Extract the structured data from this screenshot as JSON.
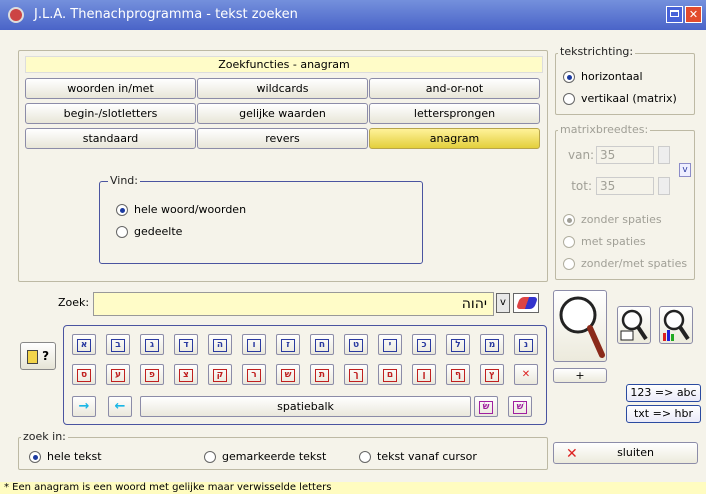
{
  "window": {
    "title": "J.L.A. Thenachprogramma - tekst zoeken"
  },
  "functions": {
    "header": "Zoekfuncties - anagram",
    "buttons": [
      "woorden in/met",
      "wildcards",
      "and-or-not",
      "begin-/slotletters",
      "gelijke waarden",
      "lettersprongen",
      "standaard",
      "revers",
      "anagram"
    ],
    "active": "anagram"
  },
  "vind": {
    "legend": "Vind:",
    "options": [
      "hele woord/woorden",
      "gedeelte"
    ],
    "selected": "hele woord/woorden"
  },
  "tekstrichting": {
    "legend": "tekstrichting:",
    "options": [
      "horizontaal",
      "vertikaal (matrix)"
    ],
    "selected": "horizontaal"
  },
  "matrix": {
    "legend": "matrixbreedtes:",
    "van_label": "van:",
    "van_value": "35",
    "tot_label": "tot:",
    "tot_value": "35",
    "v_button": "v",
    "options": [
      "zonder spaties",
      "met spaties",
      "zonder/met spaties"
    ],
    "selected": "zonder spaties"
  },
  "zoek": {
    "label": "Zoek:",
    "value": "יהוה",
    "dropdown": "v"
  },
  "help": {
    "label": "?"
  },
  "keyboard": {
    "row1": [
      "א",
      "ב",
      "ג",
      "ד",
      "ה",
      "ו",
      "ז",
      "ח",
      "ט",
      "י",
      "כ",
      "ל",
      "מ",
      "נ"
    ],
    "row2": [
      "ס",
      "ע",
      "פ",
      "צ",
      "ק",
      "ר",
      "ש",
      "ת",
      "ך",
      "ם",
      "ן",
      "ף",
      "ץ"
    ],
    "delete": "✕",
    "row3": [
      "שׂ",
      "שׁ"
    ],
    "arrow_right": "→",
    "arrow_left": "←",
    "space": "spatiebalk"
  },
  "tools": {
    "plus": "+",
    "btn_123": "123 => abc",
    "btn_txt": "txt => hbr"
  },
  "zoek_in": {
    "legend": "zoek in:",
    "options": [
      "hele tekst",
      "gemarkeerde tekst",
      "tekst vanaf cursor"
    ],
    "selected": "hele tekst"
  },
  "close": {
    "label": "sluiten"
  },
  "status": "* Een anagram is een woord met gelijke maar verwisselde letters",
  "colors": {
    "title_bar": "#4a64c8",
    "active_button": "#e3cf3c",
    "header_bg": "#fffcc8"
  }
}
